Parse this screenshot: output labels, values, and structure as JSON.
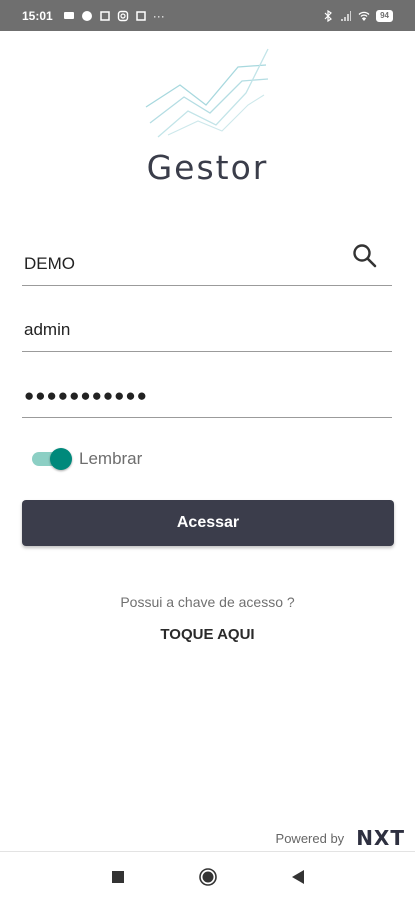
{
  "status_bar": {
    "time": "15:01",
    "more": "···",
    "battery": "94"
  },
  "app": {
    "brand": "Gestor"
  },
  "form": {
    "server_value": "DEMO",
    "user_value": "admin",
    "password_mask": "●●●●●●●●●●●",
    "remember_label": "Lembrar",
    "remember_on": true,
    "submit_label": "Acessar"
  },
  "access_key": {
    "question": "Possui a chave de acesso ?",
    "action": "TOQUE AQUI"
  },
  "footer": {
    "powered_by": "Powered by",
    "vendor": "NXT"
  },
  "colors": {
    "primary": "#3b3d4b",
    "toggle_thumb": "#00897b",
    "toggle_track": "#8ccfc4",
    "logo_lines": "#a7d8de"
  }
}
